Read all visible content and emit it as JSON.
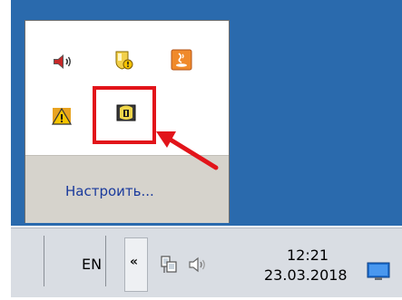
{
  "tray_popup": {
    "customize_label": "Настроить..."
  },
  "taskbar": {
    "language": "EN",
    "time": "12:21",
    "date": "23.03.2018"
  },
  "icons": [
    "speaker-icon",
    "shield-notification-icon",
    "java-icon",
    "warning-icon",
    "security-agent-icon",
    "network-icon",
    "volume-icon",
    "show-desktop-icon"
  ],
  "colors": {
    "desktop": "#2a6aad",
    "highlight": "#e2141a",
    "link": "#1a3a9c",
    "taskbar": "#d9dde3"
  }
}
